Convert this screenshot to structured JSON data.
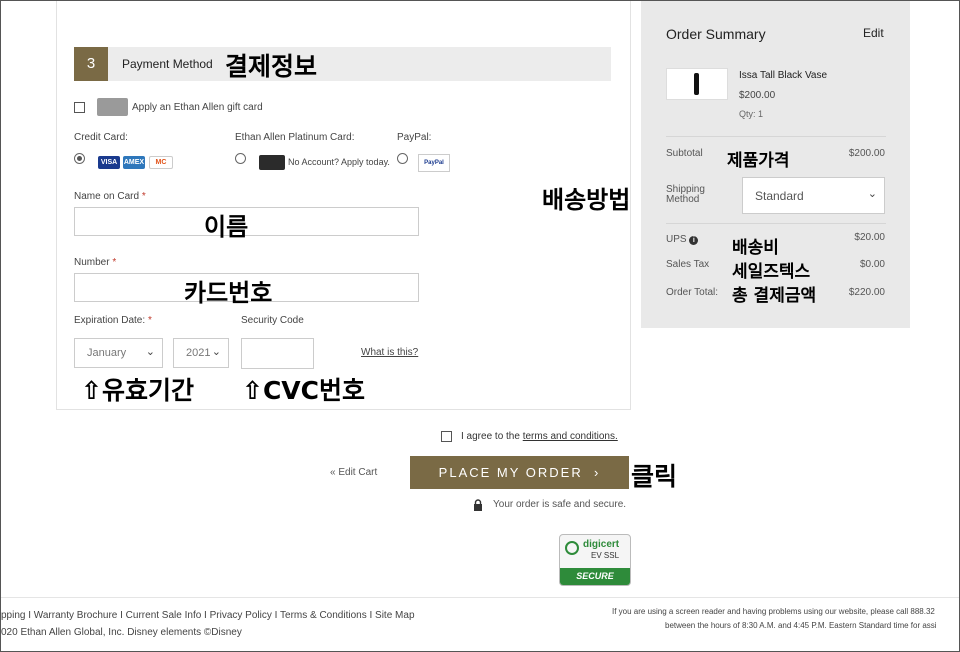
{
  "payment": {
    "step": "3",
    "title": "Payment Method",
    "gift_card_label": "Apply an Ethan Allen gift card",
    "credit_card_label": "Credit Card:",
    "platinum_label": "Ethan Allen Platinum Card:",
    "no_account_label": "No Account? Apply today.",
    "paypal_label": "PayPal:",
    "paypal_logo": "PayPal",
    "name_label": "Name on Card",
    "number_label": "Number",
    "expiration_label": "Expiration Date:",
    "security_label": "Security Code",
    "month_value": "January",
    "year_value": "2021",
    "what_is_this": "What is this?",
    "required_mark": "*",
    "card_logos": [
      "VISA",
      "AMEX",
      "MC"
    ]
  },
  "annotations": {
    "payment_info": "결제정보",
    "name": "이름",
    "card_number": "카드번호",
    "expiry": "⇧유효기간",
    "cvc": "⇧CVC번호",
    "shipping_method": "배송방법",
    "product_price": "제품가격",
    "shipping_fee": "배송비",
    "sales_tax": "세일즈텍스",
    "total": "총 결제금액",
    "click": "클릭"
  },
  "summary": {
    "title": "Order Summary",
    "edit": "Edit",
    "product_name": "Issa Tall Black Vase",
    "product_price": "$200.00",
    "qty": "Qty: 1",
    "subtotal_label": "Subtotal",
    "subtotal_value": "$200.00",
    "shipping_label": "Shipping Method",
    "shipping_value": "Standard",
    "ups_label": "UPS",
    "ups_value": "$20.00",
    "tax_label": "Sales Tax",
    "tax_value": "$0.00",
    "total_label": "Order Total:",
    "total_value": "$220.00"
  },
  "checkout": {
    "agree_prefix": "I agree to the",
    "terms_link": "terms and conditions.",
    "edit_cart": "« Edit Cart",
    "place_order": "PLACE MY ORDER",
    "secure_text": "Your order is safe and secure."
  },
  "badge": {
    "brand": "digicert",
    "type": "EV SSL",
    "secure": "SECURE"
  },
  "footer": {
    "links": "pping I Warranty Brochure I Current Sale Info I  Privacy Policy I Terms & Conditions I Site Map",
    "copyright": "020 Ethan Allen Global, Inc. Disney elements ©Disney",
    "screen_reader_1": "If you are using a screen reader and having problems using our website, please call 888.32",
    "screen_reader_2": "between the hours of 8:30 A.M. and 4:45 P.M. Eastern Standard time for assi"
  },
  "colors": {
    "accent": "#7a6a45",
    "summary_bg": "#e9e9e9",
    "section_bg": "#ececec"
  }
}
